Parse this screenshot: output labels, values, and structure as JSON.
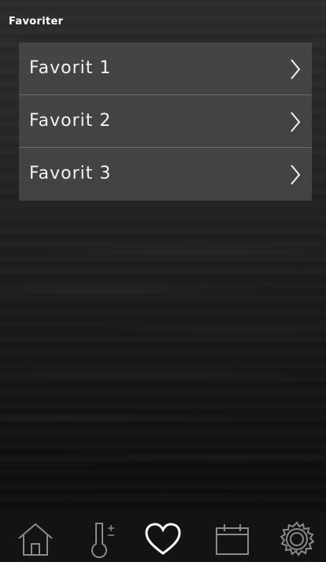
{
  "header": {
    "title": "Favoriter"
  },
  "favorites": {
    "items": [
      {
        "label": "Favorit 1",
        "icon": "chevron-right-icon"
      },
      {
        "label": "Favorit 2",
        "icon": "chevron-right-icon"
      },
      {
        "label": "Favorit 3",
        "icon": "chevron-right-icon"
      }
    ]
  },
  "tabbar": {
    "tabs": [
      {
        "icon": "home-icon",
        "active": false
      },
      {
        "icon": "thermometer-icon",
        "active": false
      },
      {
        "icon": "heart-icon",
        "active": true
      },
      {
        "icon": "calendar-icon",
        "active": false
      },
      {
        "icon": "gear-icon",
        "active": false
      }
    ],
    "active_color": "#ffffff",
    "inactive_color": "#8a8a8a"
  }
}
